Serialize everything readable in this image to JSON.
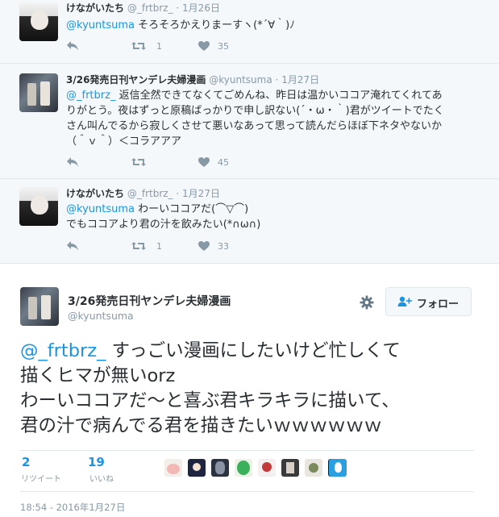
{
  "thread": [
    {
      "name": "けながいたち",
      "handle": "@_frtbrz_",
      "sep": "·",
      "date": "1月26日",
      "lines": [
        {
          "mention": "@kyuntsuma",
          "rest": " そろそろかえりまーすヽ(*´∀｀)ﾉ"
        }
      ],
      "retweets": "1",
      "likes": "35"
    },
    {
      "name": "3/26発売日刊ヤンデレ夫婦漫画",
      "handle": "@kyuntsuma",
      "sep": "·",
      "date": "1月27日",
      "lines": [
        {
          "mention": "@_frtbrz_",
          "rest": " 返信全然できてなくてごめんね、昨日は温かいココア淹れてくれてあ"
        },
        {
          "mention": "",
          "rest": "りがとう。夜はずっと原稿ばっかりで申し訳ない(´・ω・｀)君がツイートでたく"
        },
        {
          "mention": "",
          "rest": "さん叫んでるから寂しくさせて悪いなあって思って読んだらほぼ下ネタやないか"
        },
        {
          "mention": "",
          "rest": "（＾ｖ＾）＜コラアアア"
        }
      ],
      "retweets": "",
      "likes": "45"
    },
    {
      "name": "けながいたち",
      "handle": "@_frtbrz_",
      "sep": "·",
      "date": "1月27日",
      "lines": [
        {
          "mention": "@kyuntsuma",
          "rest": " わーいココアだ(⌒▽⌒)"
        },
        {
          "mention": "",
          "rest": "でもココアより君の汁を飲みたい(*∩ω∩)"
        }
      ],
      "retweets": "1",
      "likes": "33"
    }
  ],
  "main": {
    "name": "3/26発売日刊ヤンデレ夫婦漫画",
    "handle": "@kyuntsuma",
    "follow_label": "フォロー",
    "text_lines": [
      {
        "mention": "@_frtbrz_",
        "rest": " すっごい漫画にしたいけど忙しくて"
      },
      {
        "mention": "",
        "rest": "描くヒマが無いorz"
      },
      {
        "mention": "",
        "rest": "わーいココアだ〜と喜ぶ君キラキラに描いて、"
      },
      {
        "mention": "",
        "rest": "君の汁で病んでる君を描きたいｗｗｗｗｗｗ"
      }
    ],
    "retweet_count": "2",
    "retweet_label": "リツイート",
    "like_count": "19",
    "like_label": "いいね",
    "timestamp": "18:54 - 2016年1月27日"
  },
  "colors": {
    "link": "#1b95e0",
    "meta": "#8899a6",
    "border": "#e1e8ed",
    "thread_bg": "#f5f8fa"
  },
  "icons": [
    "reply-icon",
    "retweet-icon",
    "heart-icon",
    "gear-icon",
    "follow-person-icon"
  ]
}
